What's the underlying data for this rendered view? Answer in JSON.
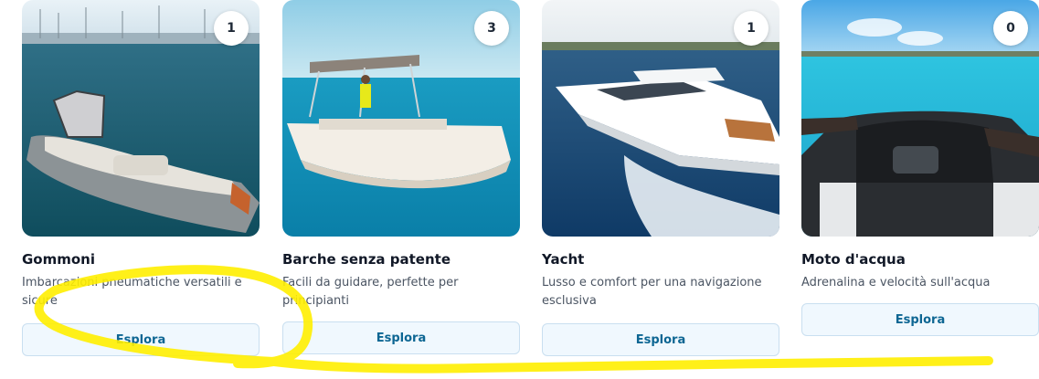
{
  "cards": [
    {
      "title": "Gommoni",
      "description": "Imbarcazioni pneumatiche versatili e sicure",
      "count": "1",
      "button": "Esplora"
    },
    {
      "title": "Barche senza patente",
      "description": "Facili da guidare, perfette per principianti",
      "count": "3",
      "button": "Esplora"
    },
    {
      "title": "Yacht",
      "description": "Lusso e comfort per una navigazione esclusiva",
      "count": "1",
      "button": "Esplora"
    },
    {
      "title": "Moto d'acqua",
      "description": "Adrenalina e velocità sull'acqua",
      "count": "0",
      "button": "Esplora"
    }
  ],
  "colors": {
    "button_text": "#0d6693",
    "button_bg": "#f0f8fe",
    "annotation": "#ffee00"
  }
}
